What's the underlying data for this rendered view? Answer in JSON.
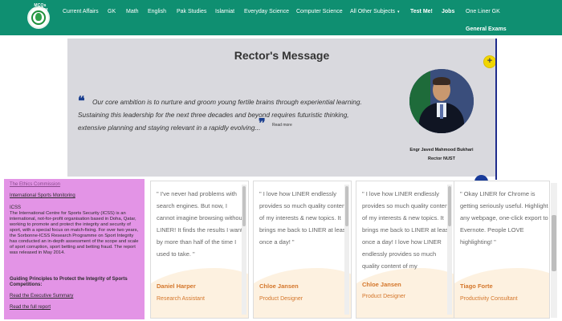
{
  "nav": {
    "logo_text": "MCQs FORUM",
    "items": [
      {
        "label": "Current Affairs"
      },
      {
        "label": "GK"
      },
      {
        "label": "Math"
      },
      {
        "label": "English"
      },
      {
        "label": "Pak Studies"
      },
      {
        "label": "Islamiat"
      },
      {
        "label": "Everyday Science"
      },
      {
        "label": "Computer Science"
      },
      {
        "label": "All Other Subjects"
      },
      {
        "label": "Test Me!"
      },
      {
        "label": "Jobs"
      },
      {
        "label": "One Liner GK"
      },
      {
        "label": "General Exams"
      }
    ],
    "dropdown_caret": "▾"
  },
  "rector": {
    "title": "Rector's Message",
    "open_quote": "❝",
    "close_quote": "❞",
    "quote_line1": "Our core ambition is to nurture and groom young fertile brains through experiential learning.",
    "quote_line2": "Sustaining this leadership for the next three decades and beyond requires futuristic thinking,",
    "quote_line3": "extensive planning and staying relevant in a rapidly evolving...",
    "read_more": "Read more",
    "name": "Engr Javed Mahmood Bukhari",
    "designation": "Rector NUST",
    "plus_label": "+"
  },
  "ethics": {
    "heading_link": "The Ethics Commission",
    "sports_link": "International Sports Monitoring",
    "icss": "ICSS",
    "body": "The International Centre for Sports Security (ICSS) is an international, not-for-profit organisation based in Doha, Qatar, working to promote and protect the integrity and security of sport, with a special focus on match-fixing. For over two years, the Sorbonne-ICSS Research Programme on Sport Integrity has conducted an in-depth assessment of the scope and scale of sport corruption, sport betting and betting fraud. The report was released in May 2014.",
    "guiding": "Guiding Principles to Protect the Integrity of Sports Competitions:",
    "summary_link": "Read the Executive Summary",
    "full_link": "Read the full report"
  },
  "testimonials": [
    {
      "quote": "\" I've never had problems with search engines. But now, I cannot imagine browsing without LINER! It finds the results I want by more than half of the time I used to take. \"",
      "name": "Daniel Harper",
      "role": "Research Assistant"
    },
    {
      "quote": "\" I love how LINER endlessly provides so much quality content of my interests & new topics. It brings me back to LINER at least once a day! \"",
      "name": "Chloe Jansen",
      "role": "Product Designer"
    },
    {
      "quote": "\" I love how LINER endlessly provides so much quality content of my interests & new topics. It brings me back to LINER at least once a day! I love how LINER endlessly provides so much quality content of my",
      "name": "Chloe Jansen",
      "role": "Product Designer"
    },
    {
      "quote": "\" Okay LINER for Chrome is getting seriously useful. Highlight any webpage, one-click export to Evernote. People LOVE highlighting! \"",
      "name": "Tiago Forte",
      "role": "Productivity Consultant"
    }
  ],
  "colors": {
    "nav_bg": "#0f8f71",
    "accent_orange": "#d4762a",
    "ethics_bg": "#e394e6",
    "rector_bg": "#d9d9de"
  }
}
